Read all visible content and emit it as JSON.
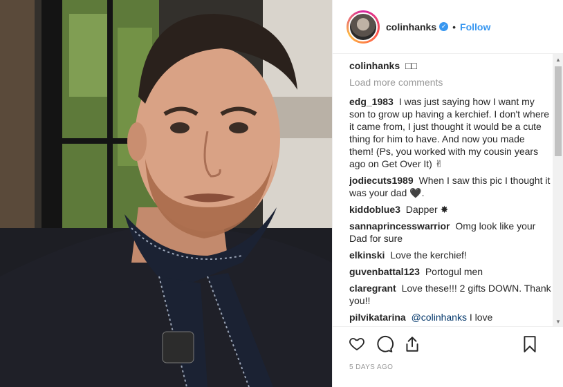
{
  "post": {
    "username": "colinhanks",
    "verified_glyph": "✓",
    "separator": "•",
    "follow_label": "Follow",
    "timestamp": "5 DAYS AGO"
  },
  "caption": {
    "username": "colinhanks",
    "text": "□□"
  },
  "load_more_label": "Load more comments",
  "comments": [
    {
      "user": "edg_1983",
      "text": "I was just saying how I want my son to grow up having a kerchief. I don't where it came from, I just thought it would be a cute thing for him to have. And now you made them! (Ps, you worked with my cousin years ago on Get Over It) ✌"
    },
    {
      "user": "jodiecuts1989",
      "text": "When I saw this pic I thought it was your dad 🖤."
    },
    {
      "user": "kiddoblue3",
      "text": "Dapper ✸"
    },
    {
      "user": "sannaprincesswarrior",
      "text": "Omg look like your Dad for sure"
    },
    {
      "user": "elkinski",
      "text": "Love the kerchief!"
    },
    {
      "user": "guvenbattal123",
      "text": "Portogul men"
    },
    {
      "user": "claregrant",
      "text": "Love these!!! 2 gifts DOWN. Thank you!!"
    },
    {
      "user": "pilvikatarina",
      "mention": "@colinhanks",
      "text": "I love"
    }
  ],
  "icons": {
    "like": "heart-icon",
    "comment": "comment-icon",
    "share": "share-icon",
    "save": "bookmark-icon"
  },
  "colors": {
    "accent": "#3897f0",
    "text": "#262626",
    "muted": "#999999"
  }
}
